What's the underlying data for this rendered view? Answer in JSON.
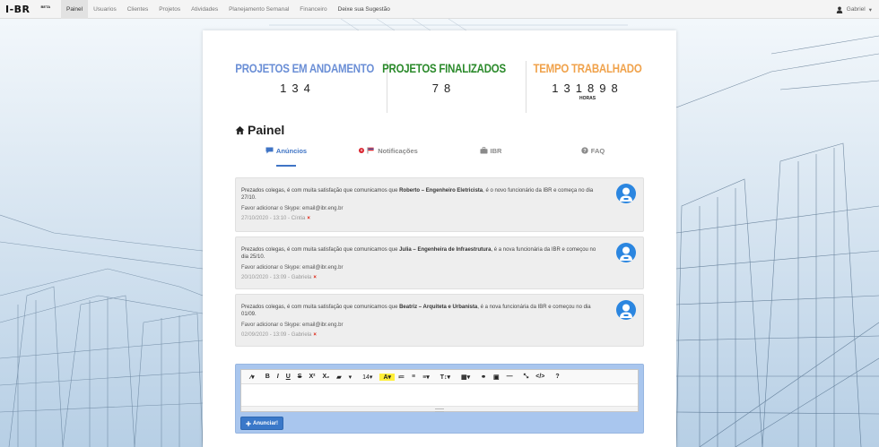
{
  "navbar": {
    "logo": "I-BR",
    "beta": "BETA",
    "items": [
      {
        "label": "Painel",
        "active": true
      },
      {
        "label": "Usuarios"
      },
      {
        "label": "Clientes"
      },
      {
        "label": "Projetos"
      },
      {
        "label": "Atividades"
      },
      {
        "label": "Planejamento Semanal"
      },
      {
        "label": "Financeiro"
      },
      {
        "label": "Deixe sua Sugestão"
      }
    ],
    "user": "Gabriel",
    "user_icon": "user-icon",
    "caret": "▾"
  },
  "stats": [
    {
      "label": "PROJETOS EM ANDAMENTO",
      "value": "134",
      "sub": "",
      "color": "#6b8fd6"
    },
    {
      "label": "PROJETOS FINALIZADOS",
      "value": "78",
      "sub": "",
      "color": "#2b8a2b"
    },
    {
      "label": "TEMPO TRABALHADO",
      "value": "131898",
      "sub": "HORAS",
      "color": "#f0a24b"
    }
  ],
  "painel": {
    "title": "Painel",
    "icon": "home-icon"
  },
  "tabs": [
    {
      "label": "Anúncios",
      "icon": "comment-icon",
      "active": true
    },
    {
      "label": "Notificações",
      "icon": "flag-icon",
      "badge": "0"
    },
    {
      "label": "IBR",
      "icon": "briefcase-icon"
    },
    {
      "label": "FAQ",
      "icon": "question-icon"
    }
  ],
  "announcements": [
    {
      "prefix": "Prezados colegas, é com muita satisfação que comunicamos que ",
      "name": "Roberto – Engenheiro Eletricista",
      "suffix": ", é o novo funcionário da IBR e começa no dia 27/10.",
      "skype": "Favor adicionar o Skype: email@ibr.eng.br",
      "meta": "27/10/2020 - 13:10 - Cíntia",
      "delete": "×"
    },
    {
      "prefix": "Prezados colegas, é com muita satisfação que comunicamos que ",
      "name": "Julia – Engenheira de Infraestrutura",
      "suffix": ", é a nova funcionária da IBR e começou no dia 25/10.",
      "skype": "Favor adicionar o Skype: email@ibr.eng.br",
      "meta": "20/10/2020 - 13:09 - Gabriela",
      "delete": "×"
    },
    {
      "prefix": "Prezados colegas, é com muita satisfação que comunicamos que ",
      "name": "Beatriz – Arquiteta e Urbanista",
      "suffix": ", é a nova funcionária da IBR e começou no dia 01/09.",
      "skype": "Favor adicionar o Skype: email@ibr.eng.br",
      "meta": "02/09/2020 - 13:09 - Gabriela",
      "delete": "×"
    }
  ],
  "editor": {
    "toolbar": [
      "⁄▾",
      "B",
      "I",
      "U",
      "S",
      "X²",
      "X₂",
      "▰",
      "▾",
      "14▾",
      "A▾",
      "≔",
      "≡",
      "≡▾",
      "T↕▾",
      "▦▾",
      "⚭",
      "▣",
      "—",
      "⤡",
      "</>",
      "?"
    ],
    "submit_label": "Anunciar!",
    "submit_icon": "plus-icon"
  }
}
